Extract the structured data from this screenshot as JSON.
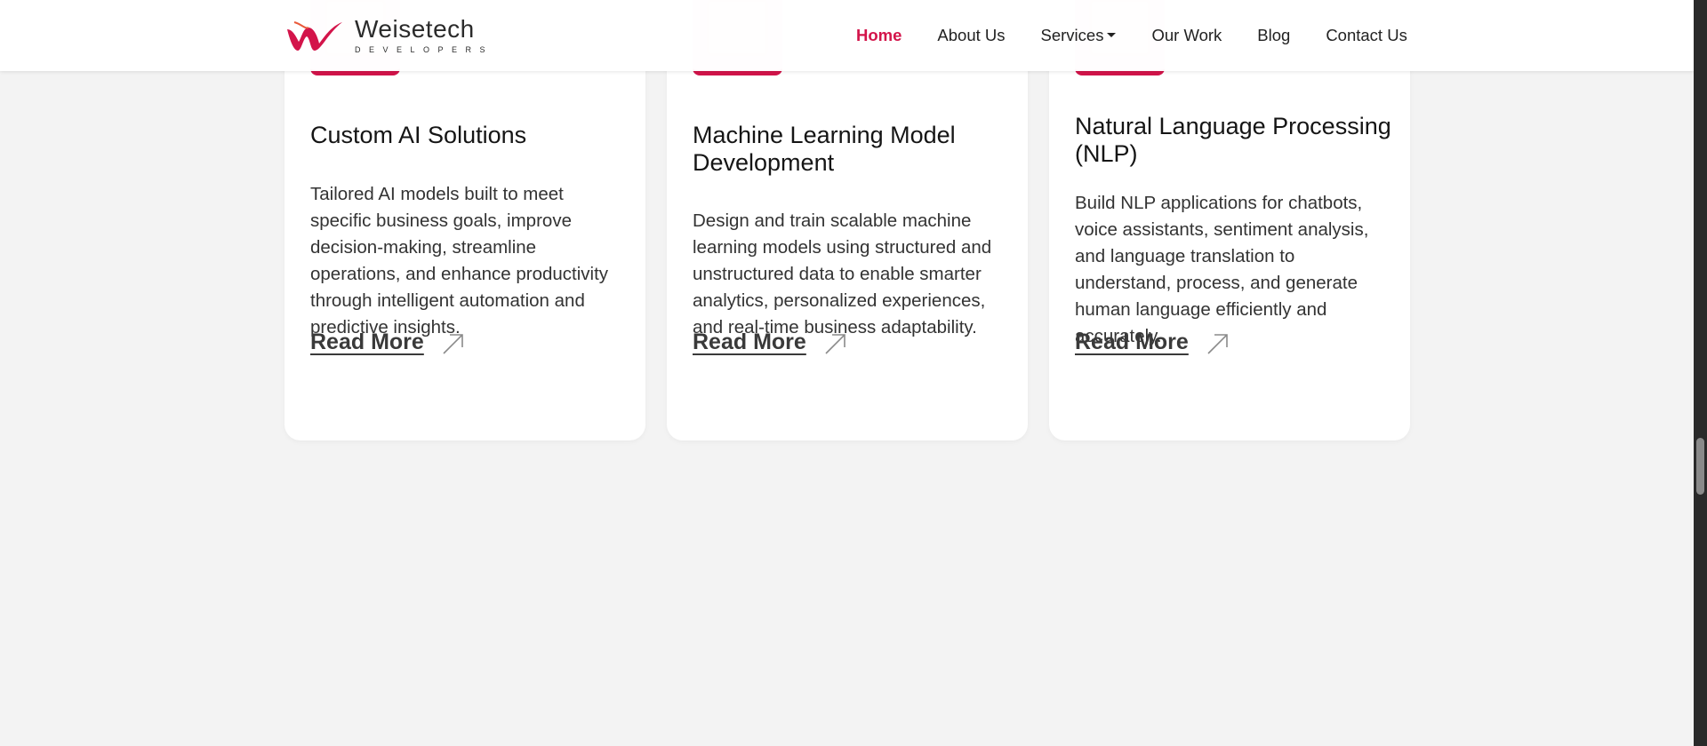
{
  "header": {
    "logo": {
      "word": "Weisetech",
      "sub": "DEVELOPERS"
    },
    "nav": [
      {
        "label": "Home",
        "active": true
      },
      {
        "label": "About Us"
      },
      {
        "label": "Services",
        "dropdown": true
      },
      {
        "label": "Our Work"
      },
      {
        "label": "Blog"
      },
      {
        "label": "Contact Us"
      }
    ]
  },
  "cards": [
    {
      "title": "Custom AI Solutions",
      "description": "Tailored AI models built to meet specific business goals, improve decision-making, streamline operations, and enhance productivity through intelligent automation and predictive insights.",
      "link_label": "Read More"
    },
    {
      "title": "Machine Learning Model Development",
      "description": "Design and train scalable machine learning models using structured and unstructured data to enable smarter analytics, personalized experiences, and real-time business adaptability.",
      "link_label": "Read More"
    },
    {
      "title": "Natural Language Processing (NLP)",
      "description": "Build NLP applications for chatbots, voice assistants, sentiment analysis, and language translation to understand, process, and generate human language efficiently and accurately.",
      "link_label": "Read More"
    }
  ],
  "colors": {
    "accent": "#d3144a",
    "page_background": "#f3f3f3",
    "card_background": "#ffffff"
  },
  "icons": {
    "read_more": "arrow-up-right-icon",
    "dropdown": "caret-down-icon"
  }
}
